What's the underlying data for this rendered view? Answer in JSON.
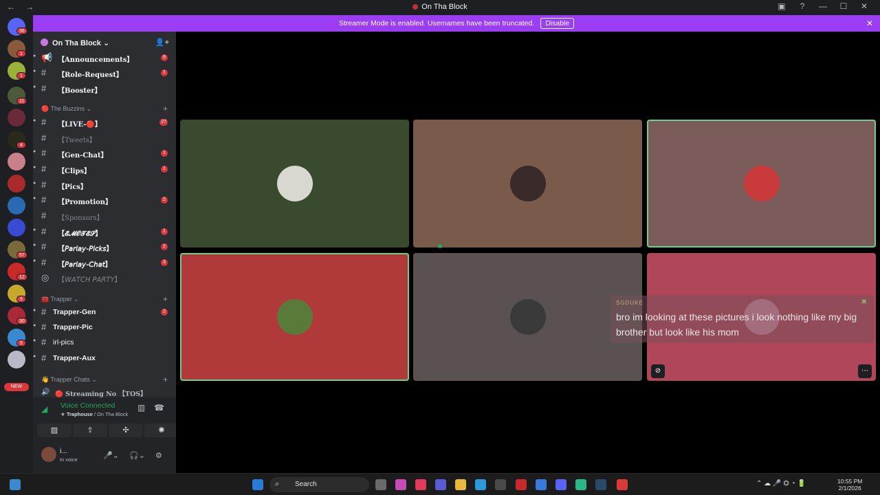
{
  "window": {
    "title": "On Tha Block",
    "nav_glyphs": "← →",
    "controls": [
      "▣",
      "?",
      "—",
      "☐",
      "✕"
    ]
  },
  "banner": {
    "text": "Streamer Mode is enabled. Usernames have been truncated.",
    "disable_label": "Disable",
    "close_glyph": "✕"
  },
  "guilds": {
    "new_label": "NEW",
    "items": [
      {
        "badge": "36"
      },
      {
        "badge": "1"
      },
      {
        "badge": "1"
      },
      {
        "badge": "11"
      },
      {
        "badge": ""
      },
      {
        "badge": "4"
      },
      {
        "badge": ""
      },
      {
        "badge": ""
      },
      {
        "badge": ""
      },
      {
        "badge": ""
      },
      {
        "badge": "57"
      },
      {
        "badge": "12"
      },
      {
        "badge": "5"
      },
      {
        "badge": "30"
      },
      {
        "badge": "5"
      },
      {
        "badge": ""
      }
    ]
  },
  "server": {
    "name": "On Tha Block ⌄",
    "invite_glyph": "👤+"
  },
  "channels": [
    {
      "name": "【Announcements】",
      "badge": "8",
      "icon": "📢"
    },
    {
      "name": "【Role-Request】",
      "badge": "1",
      "icon": "#"
    },
    {
      "name": "【Booster】",
      "badge": "",
      "icon": "#"
    },
    {
      "name": "【LIVE-🔴】",
      "badge": "27",
      "icon": "#"
    },
    {
      "name": "【Tweets】",
      "badge": "",
      "icon": "#"
    },
    {
      "name": "【Gen-Chat】",
      "badge": "1",
      "icon": "#"
    },
    {
      "name": "【Clips】",
      "badge": "1",
      "icon": "#"
    },
    {
      "name": "【Pics】",
      "badge": "",
      "icon": "#"
    },
    {
      "name": "【Promotion】",
      "badge": "2",
      "icon": "#"
    },
    {
      "name": "【Sponsors】",
      "badge": "",
      "icon": "#"
    },
    {
      "name": "【𝓔𝓜𝓞𝓣𝓔𝓢】",
      "badge": "1",
      "icon": "#"
    },
    {
      "name": "【𝘗𝘢𝘳𝘭𝘢𝘺-𝘗𝘪𝘤𝘬𝘴】",
      "badge": "2",
      "icon": "#"
    },
    {
      "name": "【𝘗𝘢𝘳𝘭𝘢𝘺-𝘊𝘩𝘢𝘵】",
      "badge": "3",
      "icon": "#"
    },
    {
      "name": "【𝘞𝘈𝘛𝘊𝘏 𝘗𝘈𝘙𝘛𝘠】",
      "badge": "",
      "icon": "◎"
    },
    {
      "name": "Trapper-Gen",
      "badge": "2",
      "icon": "#"
    },
    {
      "name": "Trapper-Pic",
      "badge": "",
      "icon": "#"
    },
    {
      "name": "irl-pics",
      "badge": "",
      "icon": "#"
    },
    {
      "name": "Trapper-Aux",
      "badge": "",
      "icon": "#"
    },
    {
      "name": "🔴 Streaming No 【TOS】",
      "badge": "",
      "icon": "🔊"
    }
  ],
  "categories": [
    "🔴 The Buzzins ⌄",
    "🧰 Trapper ⌄",
    "👋 Trapper Chats ⌄"
  ],
  "voice": {
    "status": "Voice Connected",
    "channel": "Traphouse",
    "server": "/ On Tha Block",
    "buttons": [
      "▨",
      "⇪",
      "✣",
      "✺"
    ]
  },
  "user": {
    "name": "i...",
    "status": "In voice"
  },
  "overlay": {
    "name": "SGDUKE",
    "text": "bro im looking at these pictures i look nothing like my big brother but look like his mom"
  },
  "taskbar": {
    "search_label": "Search",
    "time": "10:55 PM",
    "date": "2/1/2026",
    "tray_glyphs": "⌃  ☁  🎤  ⏣  ◔  🔋"
  },
  "colors": {
    "accent": "#9b3df2",
    "speaking": "#6fd08c",
    "badge": "#da373c",
    "tiles": [
      "#3a4a2e",
      "#7a5a4a",
      "#7b5a5a",
      "#b03a3a",
      "#5a5252",
      "#b0465a"
    ]
  }
}
